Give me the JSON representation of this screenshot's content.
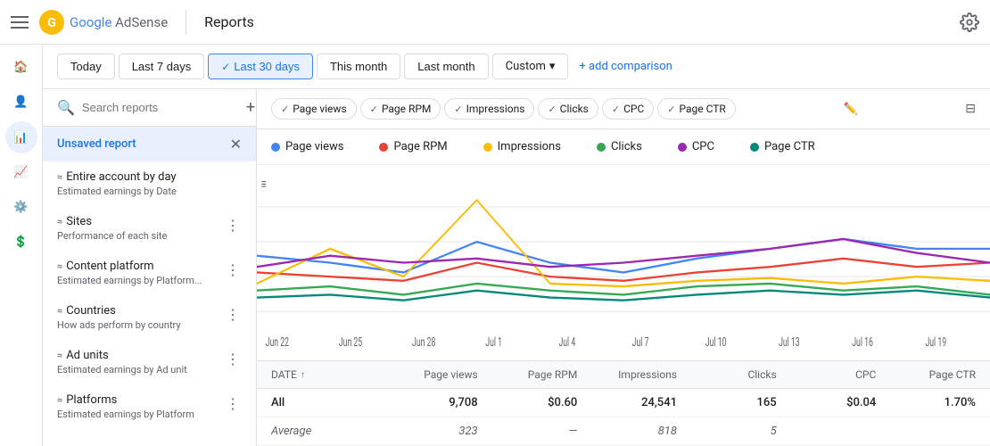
{
  "topbar": {
    "menu_label": "menu",
    "logo_text": "Google AdSense",
    "divider": true,
    "page_title": "Reports",
    "settings_label": "settings"
  },
  "filter_bar": {
    "buttons": [
      {
        "id": "today",
        "label": "Today",
        "active": false
      },
      {
        "id": "last7days",
        "label": "Last 7 days",
        "active": false
      },
      {
        "id": "last30days",
        "label": "Last 30 days",
        "active": true
      },
      {
        "id": "thismonth",
        "label": "This month",
        "active": false
      },
      {
        "id": "lastmonth",
        "label": "Last month",
        "active": false
      }
    ],
    "custom_label": "Custom",
    "add_comparison_label": "+ add comparison"
  },
  "sidebar": {
    "search_placeholder": "Search reports",
    "add_label": "+",
    "active_item": {
      "label": "Unsaved report",
      "close_label": "✕"
    },
    "items": [
      {
        "id": "entire-account",
        "name": "Entire account by day",
        "desc": "Estimated earnings by Date",
        "icon": "≈"
      },
      {
        "id": "sites",
        "name": "Sites",
        "desc": "Performance of each site",
        "icon": "≈"
      },
      {
        "id": "content-platform",
        "name": "Content platform",
        "desc": "Estimated earnings by Platform...",
        "icon": "≈"
      },
      {
        "id": "countries",
        "name": "Countries",
        "desc": "How ads perform by country",
        "icon": "≈"
      },
      {
        "id": "ad-units",
        "name": "Ad units",
        "desc": "Estimated earnings by Ad unit",
        "icon": "≈"
      },
      {
        "id": "platforms",
        "name": "Platforms",
        "desc": "Estimated earnings by Platform",
        "icon": "≈"
      }
    ]
  },
  "metrics_chips": [
    {
      "label": "Page views",
      "color": "#4285f4"
    },
    {
      "label": "Page RPM",
      "color": "#ea4335"
    },
    {
      "label": "Impressions",
      "color": "#fbbc04"
    },
    {
      "label": "Clicks",
      "color": "#34a853"
    },
    {
      "label": "CPC",
      "color": "#9c27b0"
    },
    {
      "label": "Page CTR",
      "color": "#00897b"
    }
  ],
  "legend": [
    {
      "label": "Page views",
      "color": "#4285f4"
    },
    {
      "label": "Page RPM",
      "color": "#ea4335"
    },
    {
      "label": "Impressions",
      "color": "#fbbc04"
    },
    {
      "label": "Clicks",
      "color": "#34a853"
    },
    {
      "label": "CPC",
      "color": "#9c27b0"
    },
    {
      "label": "Page CTR",
      "color": "#00897b"
    }
  ],
  "chart": {
    "x_labels": [
      "Jun 22",
      "Jun 25",
      "Jun 28",
      "Jul 1",
      "Jul 4",
      "Jul 7",
      "Jul 10",
      "Jul 13",
      "Jul 16",
      "Jul 19"
    ],
    "series": {
      "page_views": [
        55,
        52,
        48,
        60,
        50,
        48,
        52,
        58,
        62,
        58
      ],
      "page_rpm": [
        40,
        38,
        36,
        45,
        38,
        36,
        40,
        44,
        48,
        45
      ],
      "impressions": [
        35,
        65,
        42,
        95,
        38,
        35,
        40,
        42,
        38,
        36
      ],
      "clicks": [
        30,
        32,
        28,
        35,
        30,
        28,
        32,
        35,
        30,
        28
      ],
      "cpc": [
        45,
        55,
        50,
        52,
        48,
        50,
        55,
        60,
        65,
        58
      ],
      "page_ctr": [
        25,
        28,
        24,
        30,
        26,
        24,
        28,
        32,
        30,
        28
      ]
    }
  },
  "table": {
    "columns": [
      {
        "label": "DATE",
        "sort": "↑",
        "align": "left"
      },
      {
        "label": "Page views",
        "align": "right"
      },
      {
        "label": "Page RPM",
        "align": "right"
      },
      {
        "label": "Impressions",
        "align": "right"
      },
      {
        "label": "Clicks",
        "align": "right"
      },
      {
        "label": "CPC",
        "align": "right"
      },
      {
        "label": "Page CTR",
        "align": "right"
      }
    ],
    "rows": [
      {
        "date": "All",
        "page_views": "9,708",
        "page_rpm": "$0.60",
        "impressions": "24,541",
        "clicks": "165",
        "cpc": "$0.04",
        "page_ctr": "1.70%",
        "bold": true
      },
      {
        "date": "Average",
        "page_views": "323",
        "page_rpm": "—",
        "impressions": "818",
        "clicks": "5",
        "cpc": "",
        "page_ctr": "",
        "italic": true
      }
    ]
  }
}
